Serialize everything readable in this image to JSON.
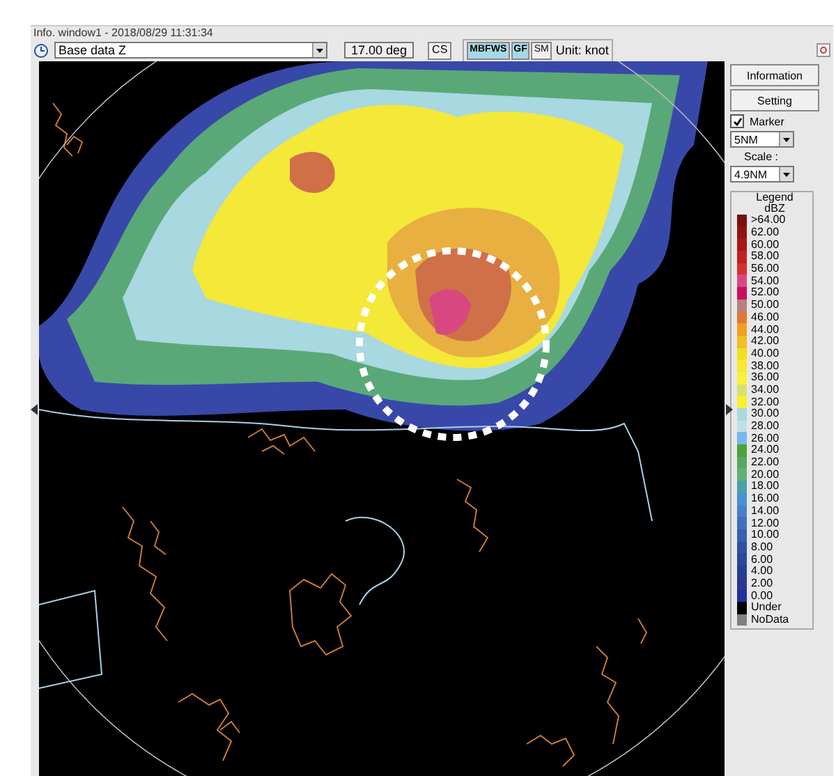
{
  "window": {
    "title": "Info. window1 - 2018/08/29 11:31:34"
  },
  "toolbar": {
    "product": "Base data Z",
    "angle": "17.00 deg",
    "cs_button": "CS",
    "toggles": [
      {
        "label": "MBFWS",
        "selected": true
      },
      {
        "label": "GF",
        "selected": true
      },
      {
        "label": "SM",
        "selected": false
      }
    ],
    "unit": "Unit: knot"
  },
  "side_panel": {
    "buttons": [
      "Information",
      "Setting"
    ],
    "marker": {
      "label": "Marker",
      "checked": true
    },
    "marker_size": "5NM",
    "scale_label": "Scale :",
    "scale": "4.9NM",
    "legend": {
      "title": "Legend",
      "unit": "dBZ",
      "items": [
        {
          "label": ">64.00",
          "color": "#7a1010"
        },
        {
          "label": "62.00",
          "color": "#8e1414"
        },
        {
          "label": "60.00",
          "color": "#a81818"
        },
        {
          "label": "58.00",
          "color": "#c42020"
        },
        {
          "label": "56.00",
          "color": "#d83030"
        },
        {
          "label": "54.00",
          "color": "#d84880"
        },
        {
          "label": "52.00",
          "color": "#c8105a"
        },
        {
          "label": "50.00",
          "color": "#b88080"
        },
        {
          "label": "46.00",
          "color": "#e07838"
        },
        {
          "label": "44.00",
          "color": "#f0a020"
        },
        {
          "label": "42.00",
          "color": "#f0c020"
        },
        {
          "label": "40.00",
          "color": "#f0e020"
        },
        {
          "label": "38.00",
          "color": "#f8e830"
        },
        {
          "label": "36.00",
          "color": "#f8f040"
        },
        {
          "label": "34.00",
          "color": "#d8e070"
        },
        {
          "label": "32.00",
          "color": "#f8f030"
        },
        {
          "label": "30.00",
          "color": "#a8d8e0"
        },
        {
          "label": "28.00",
          "color": "#c0e0e8"
        },
        {
          "label": "26.00",
          "color": "#78b8f0"
        },
        {
          "label": "24.00",
          "color": "#50a040"
        },
        {
          "label": "22.00",
          "color": "#58a860"
        },
        {
          "label": "20.00",
          "color": "#60b078"
        },
        {
          "label": "18.00",
          "color": "#48a0a8"
        },
        {
          "label": "16.00",
          "color": "#4890d8"
        },
        {
          "label": "14.00",
          "color": "#4880c8"
        },
        {
          "label": "12.00",
          "color": "#4070c0"
        },
        {
          "label": "10.00",
          "color": "#3860b0"
        },
        {
          "label": "8.00",
          "color": "#3050a0"
        },
        {
          "label": "6.00",
          "color": "#284898"
        },
        {
          "label": "4.00",
          "color": "#204090"
        },
        {
          "label": "2.00",
          "color": "#283890"
        },
        {
          "label": "0.00",
          "color": "#2030a0"
        },
        {
          "label": "Under",
          "color": "#000000"
        },
        {
          "label": "NoData",
          "color": "#808080"
        }
      ]
    }
  }
}
